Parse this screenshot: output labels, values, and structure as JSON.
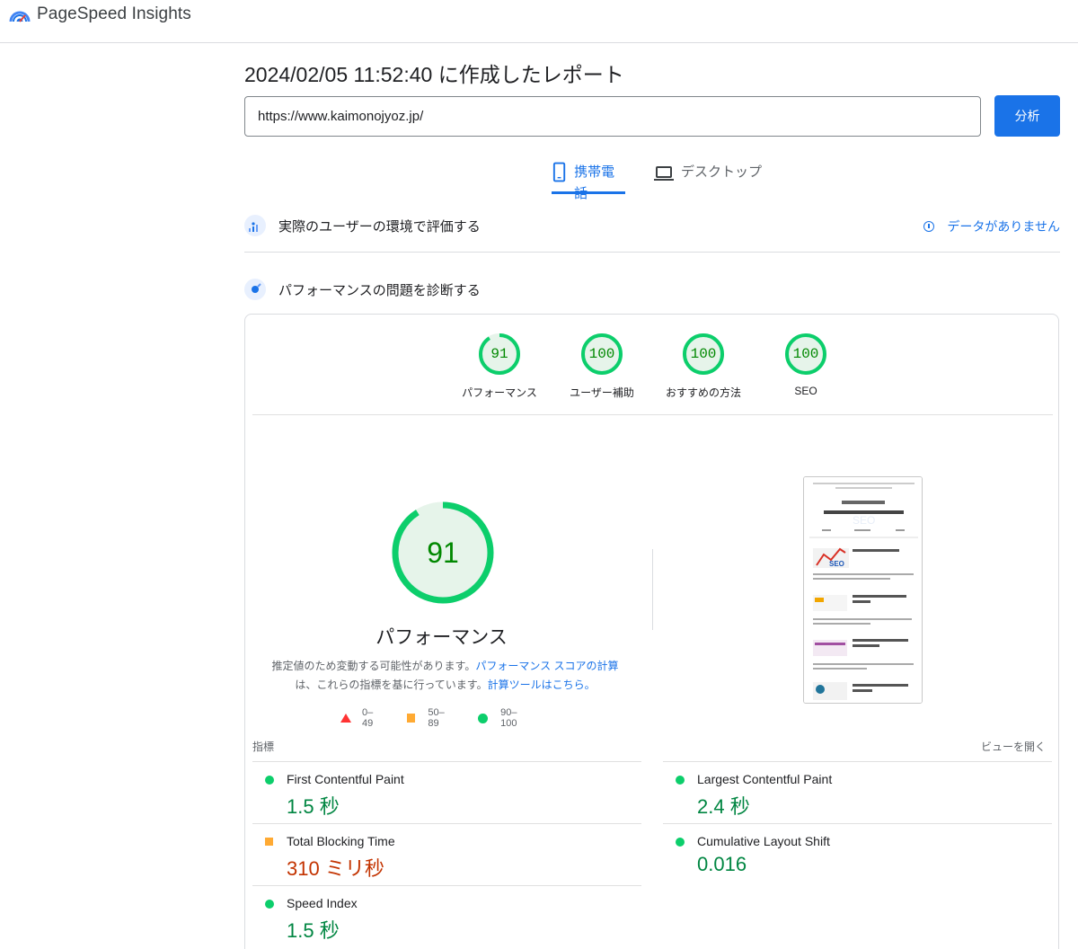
{
  "header": {
    "brand": "PageSpeed Insights"
  },
  "report": {
    "title": "2024/02/05 11:52:40 に作成したレポート",
    "url": "https://www.kaimonojyoz.jp/",
    "analyze_label": "分析"
  },
  "tabs": [
    {
      "label": "携帯電話",
      "active": true,
      "icon": "phone-icon"
    },
    {
      "label": "デスクトップ",
      "active": false,
      "icon": "laptop-icon"
    }
  ],
  "field": {
    "title": "実際のユーザーの環境で評価する",
    "status": "データがありません"
  },
  "lab": {
    "title": "パフォーマンスの問題を診断する"
  },
  "scores": [
    {
      "label": "パフォーマンス",
      "value": "91"
    },
    {
      "label": "ユーザー補助",
      "value": "100"
    },
    {
      "label": "おすすめの方法",
      "value": "100"
    },
    {
      "label": "SEO",
      "value": "100"
    }
  ],
  "perf": {
    "score": "91",
    "label": "パフォーマンス",
    "desc_1": "推定値のため変動する可能性があります。",
    "desc_link_1": "パフォーマンス スコアの計算",
    "desc_2": "は、これらの指標を基に行っています。",
    "desc_link_2": "計算ツールはこちら。"
  },
  "legend": {
    "fail": "0–49",
    "average": "50–89",
    "pass": "90–100"
  },
  "metrics_header": {
    "title": "指標",
    "expand": "ビューを開く"
  },
  "metrics": [
    {
      "name": "First Contentful Paint",
      "value": "1.5 秒",
      "rating": "good"
    },
    {
      "name": "Largest Contentful Paint",
      "value": "2.4 秒",
      "rating": "good"
    },
    {
      "name": "Total Blocking Time",
      "value": "310 ミリ秒",
      "rating": "average"
    },
    {
      "name": "Cumulative Layout Shift",
      "value": "0.016",
      "rating": "good"
    },
    {
      "name": "Speed Index",
      "value": "1.5 秒",
      "rating": "good"
    }
  ],
  "colors": {
    "accent": "#1a73e8",
    "pass": "#0cce6b",
    "average": "#ffaa33",
    "fail": "#ff3333"
  }
}
